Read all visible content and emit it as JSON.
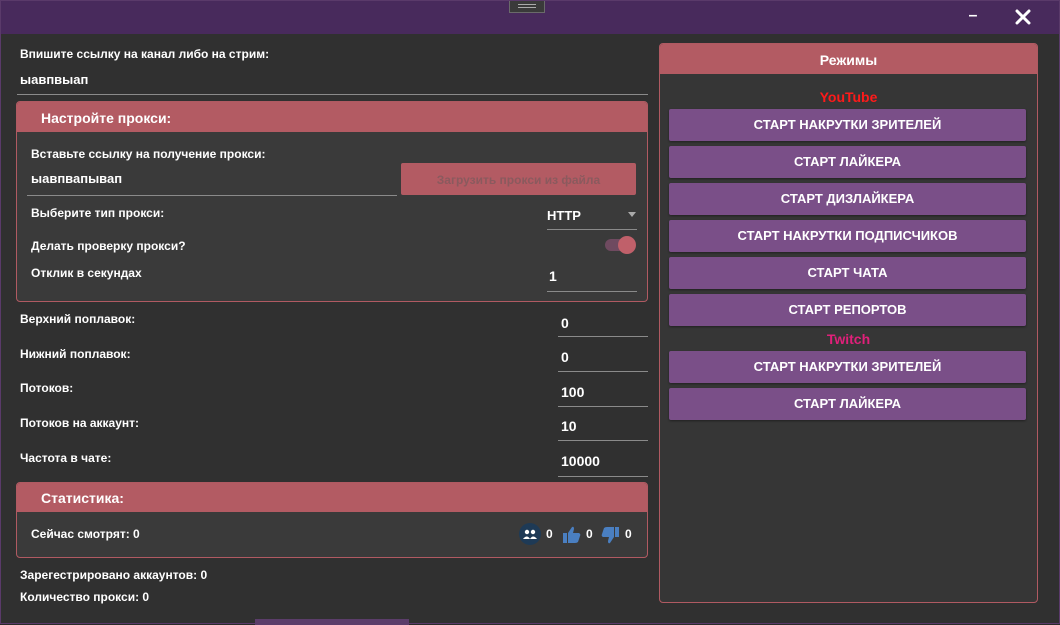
{
  "window": {
    "minimize_label": "–",
    "close_icon": "close-icon"
  },
  "channel": {
    "label": "Впишите ссылку на канал либо на стрим:",
    "value": "ыавпвыап"
  },
  "proxy": {
    "title": "Настройте прокси:",
    "url_label": "Вставьте ссылку на получение прокси:",
    "url_value": "ыавпвапывап",
    "load_button": "Загрузить прокси из файла",
    "type_label": "Выберите тип прокси:",
    "type_value": "HTTP",
    "check_label": "Делать проверку прокси?",
    "check_enabled": true,
    "timeout_label": "Отклик в секундах",
    "timeout_value": "1"
  },
  "settings": {
    "upper_float_label": "Верхний поплавок:",
    "upper_float_value": "0",
    "lower_float_label": "Нижний поплавок:",
    "lower_float_value": "0",
    "threads_label": "Потоков:",
    "threads_value": "100",
    "threads_per_account_label": "Потоков на аккаунт:",
    "threads_per_account_value": "10",
    "chat_freq_label": "Частота в чате:",
    "chat_freq_value": "10000"
  },
  "stats": {
    "title": "Статистика:",
    "watching": "Сейчас смотрят: 0",
    "viewers_count": "0",
    "likes_count": "0",
    "dislikes_count": "0"
  },
  "footer": {
    "registered": "Зарегестрировано аккаунтов: 0",
    "proxy_count": "Количество прокси: 0"
  },
  "modes": {
    "title": "Режимы",
    "youtube_label": "YouTube",
    "youtube_color": "#ff1a1a",
    "twitch_label": "Twitch",
    "twitch_color": "#e0207a",
    "youtube_buttons": [
      "СТАРТ НАКРУТКИ ЗРИТЕЛЕЙ",
      "СТАРТ ЛАЙКЕРА",
      "СТАРТ ДИЗЛАЙКЕРА",
      "СТАРТ НАКРУТКИ ПОДПИСЧИКОВ",
      "СТАРТ ЧАТА",
      "СТАРТ РЕПОРТОВ"
    ],
    "twitch_buttons": [
      "СТАРТ НАКРУТКИ ЗРИТЕЛЕЙ",
      "СТАРТ ЛАЙКЕРА"
    ]
  }
}
